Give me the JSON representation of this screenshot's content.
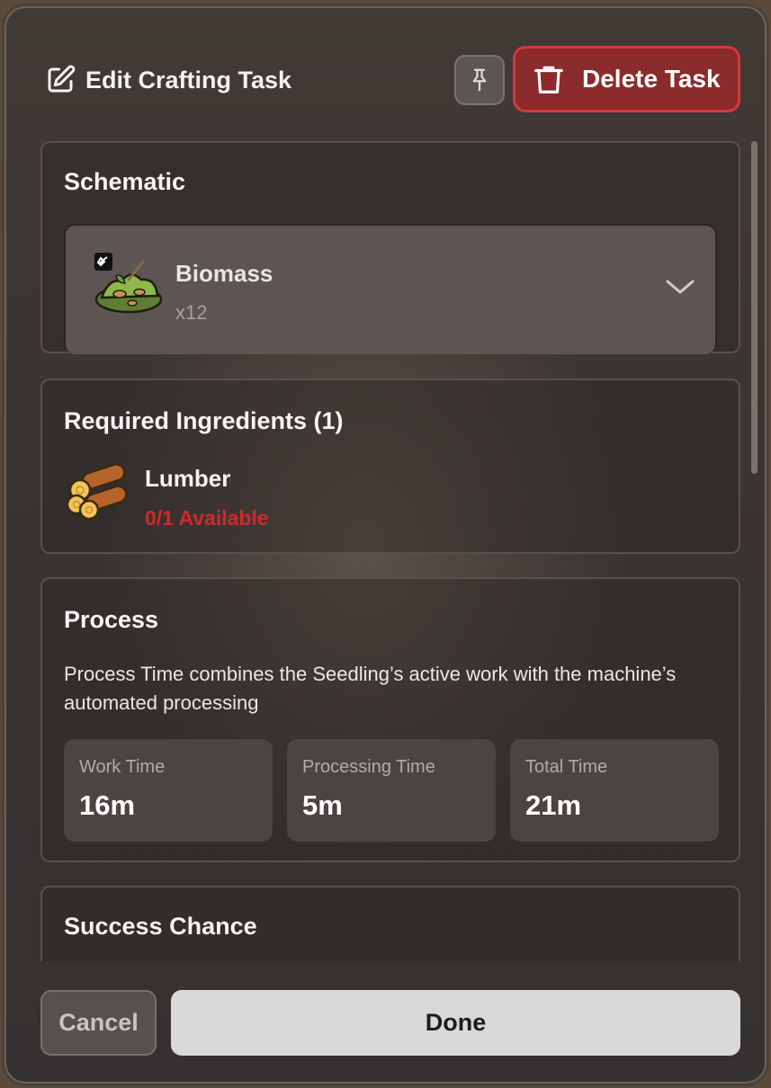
{
  "header": {
    "title": "Edit Crafting Task",
    "title_icon": "edit-icon",
    "pin_icon": "pin-icon",
    "delete_label": "Delete Task",
    "delete_icon": "trash-icon"
  },
  "schematic": {
    "section_title": "Schematic",
    "item_name": "Biomass",
    "item_quantity": "x12",
    "item_icon": "biomass-icon",
    "dropdown_icon": "chevron-down-icon"
  },
  "ingredients": {
    "section_title": "Required Ingredients (1)",
    "items": [
      {
        "name": "Lumber",
        "availability": "0/1 Available",
        "icon": "lumber-icon"
      }
    ]
  },
  "process": {
    "section_title": "Process",
    "description": "Process Time combines the Seedling’s active work with the machine’s automated processing",
    "stats": [
      {
        "label": "Work Time",
        "value": "16m"
      },
      {
        "label": "Processing Time",
        "value": "5m"
      },
      {
        "label": "Total Time",
        "value": "21m"
      }
    ]
  },
  "success": {
    "section_title": "Success Chance"
  },
  "footer": {
    "cancel_label": "Cancel",
    "done_label": "Done"
  },
  "colors": {
    "danger": "#d2393b",
    "danger_bg": "#8b2b2b",
    "unavailable_text": "#d3272b",
    "primary_button": "#d9d9d9"
  }
}
